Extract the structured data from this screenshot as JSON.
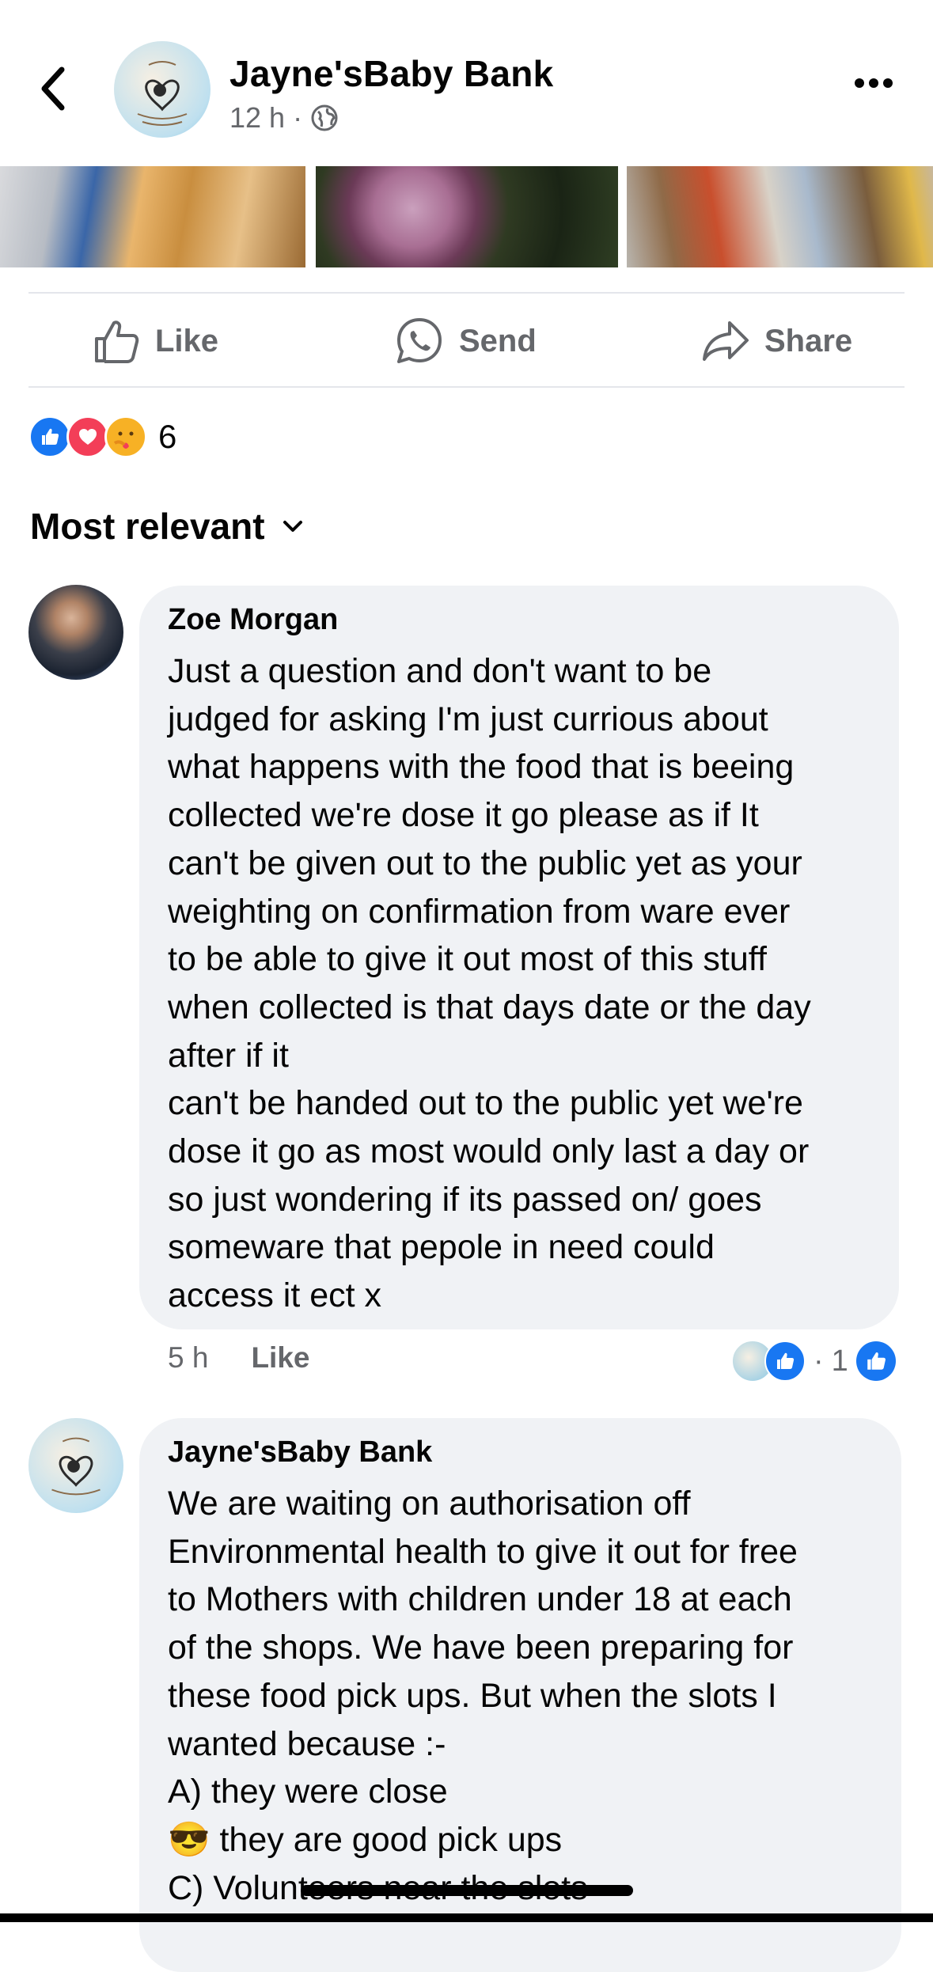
{
  "header": {
    "page_name": "Jayne'sBaby Bank",
    "time": "12 h",
    "separator": "·",
    "back_icon": "chevron-left-icon",
    "more_icon": "ellipsis-icon"
  },
  "actions": {
    "like": "Like",
    "send": "Send",
    "share": "Share"
  },
  "reactions": {
    "count": "6",
    "types": [
      "like",
      "love",
      "care"
    ],
    "colors": {
      "like": "#1877f2",
      "love": "#f33e58",
      "care": "#f7b125"
    }
  },
  "sort": {
    "label": "Most relevant",
    "icon": "chevron-down-icon"
  },
  "comments": [
    {
      "author": "Zoe Morgan",
      "text": "Just a question and don't want to be\njudged for asking I'm just currious about\nwhat happens with the food that is beeing\ncollected  we're dose it go please as if It\ncan't be given out to the public yet as your\nweighting on confirmation from ware ever\nto be able to give it out  most of this stuff\nwhen collected is that days date or the day\nafter if it\ncan't be handed out to the public yet we're\ndose it go as most would only last a day or\nso just wondering if its passed on/ goes\nsomeware that pepole in need could\naccess it ect x",
      "time": "5 h",
      "like": "Like",
      "reaction_count": "1",
      "separator": "·"
    },
    {
      "author": "Jayne'sBaby Bank",
      "text": "We are waiting on authorisation off\nEnvironmental health to give it out for free\nto Mothers with children under 18 at each\nof the shops. We have been preparing for\nthese food pick ups. But when the slots I\nwanted because  :-\nA) they were close\n😎 they are good pick ups\nC) Volunteers near the slots"
    }
  ],
  "colors": {
    "accent": "#1877f2",
    "secondary_text": "#65676b",
    "bubble": "#f0f2f5"
  }
}
